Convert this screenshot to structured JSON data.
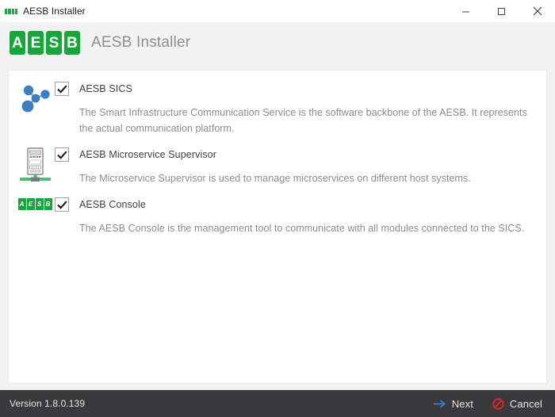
{
  "window": {
    "title": "AESB Installer",
    "icon": "aesb-logo-icon",
    "controls": {
      "minimize": "minimize-icon",
      "maximize": "maximize-icon",
      "close": "close-icon"
    }
  },
  "header": {
    "logo_letters": [
      "A",
      "E",
      "S",
      "B"
    ],
    "title": "AESB Installer",
    "brand_green": "#17a63c",
    "title_color": "#8f8f8f"
  },
  "components": [
    {
      "icon": "network-nodes-icon",
      "checked": true,
      "name": "AESB SICS",
      "description": "The Smart Infrastructure Communication Service is the software backbone of the AESB. It represents the actual communication platform."
    },
    {
      "icon": "server-device-icon",
      "checked": true,
      "name": "AESB Microservice Supervisor",
      "description": "The Microservice Supervisor is used to manage microservices on different host systems."
    },
    {
      "icon": "aesb-logo-icon",
      "checked": true,
      "name": "AESB Console",
      "description": "The AESB Console is the management tool to communicate with all modules connected to the SICS."
    }
  ],
  "footer": {
    "version": "Version 1.8.0.139",
    "next_label": "Next",
    "cancel_label": "Cancel",
    "next_icon": "arrow-right-icon",
    "cancel_icon": "no-entry-icon",
    "next_accent": "#2f7fd1",
    "cancel_accent": "#d8232a",
    "background": "#3a3a3c"
  }
}
